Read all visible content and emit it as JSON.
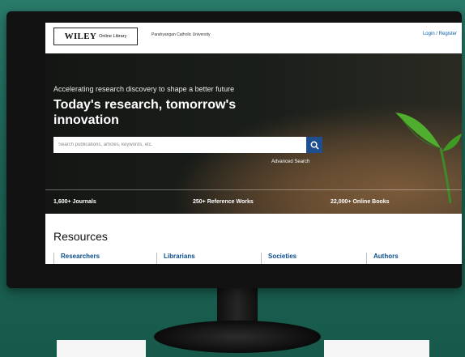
{
  "header": {
    "logo_wordmark": "WILEY",
    "logo_sub": "Online Library",
    "institution": "Parahyangan Catholic University",
    "login": "Login / Register"
  },
  "hero": {
    "tagline": "Accelerating research discovery to shape a better future",
    "headline": "Today's research, tomorrow's innovation",
    "search_placeholder": "Search publications, articles, keywords, etc.",
    "advanced_search": "Advanced Search"
  },
  "stats": [
    "1,600+ Journals",
    "250+ Reference Works",
    "22,000+ Online Books"
  ],
  "resources": {
    "title": "Resources",
    "links": [
      "Researchers",
      "Librarians",
      "Societies",
      "Authors"
    ]
  },
  "colors": {
    "brand_blue": "#1f4f8f",
    "link_blue": "#0a4c8c",
    "backdrop_green": "#1f6a5c"
  }
}
